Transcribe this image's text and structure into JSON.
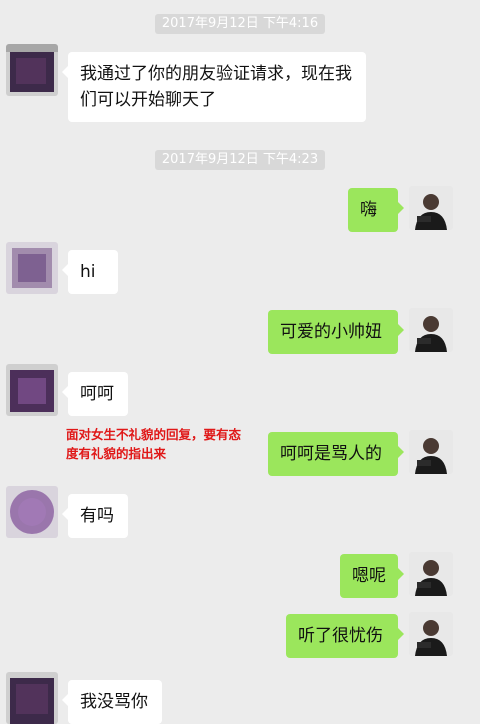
{
  "timestamps": {
    "first": "2017年9月12日 下午4:16",
    "second": "2017年9月12日 下午4:23"
  },
  "messages": {
    "m1": "我通过了你的朋友验证请求，现在我们可以开始聊天了",
    "m2": "嗨",
    "m3": "hi",
    "m4": "可爱的小帅妞",
    "m5": "呵呵",
    "m6": "呵呵是骂人的",
    "m7": "有吗",
    "m8": "嗯呢",
    "m9": "听了很忧伤",
    "m10": "我没骂你"
  },
  "annotation": "面对女生不礼貌的回复，要有态度有礼貌的指出来",
  "colors": {
    "background": "#ececec",
    "incoming_bubble": "#ffffff",
    "outgoing_bubble": "#9be65c",
    "annotation": "#e01818",
    "timestamp_bg": "#d8d8d8"
  }
}
